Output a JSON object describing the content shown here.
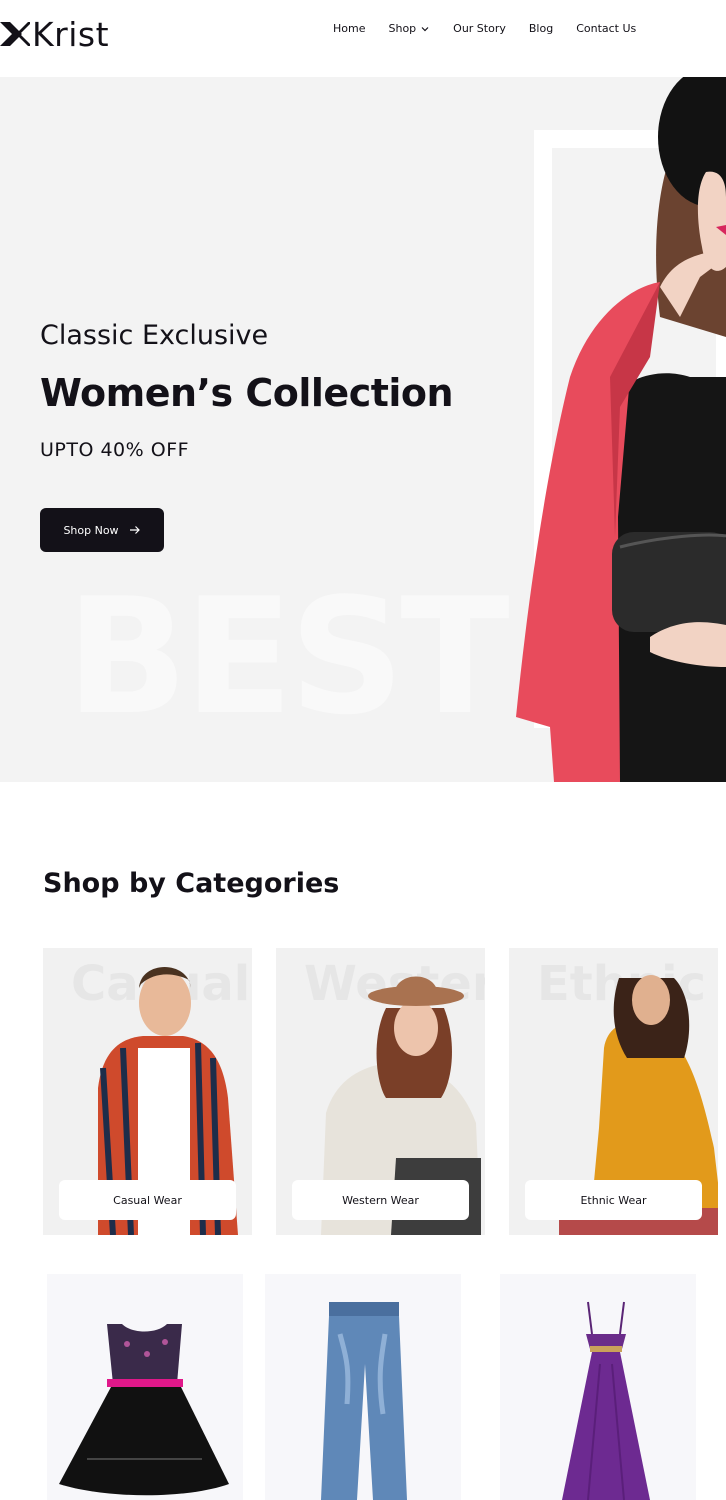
{
  "brand": {
    "name": "Krist",
    "logo_icon": "k-logo-icon"
  },
  "nav": {
    "items": [
      {
        "label": "Home"
      },
      {
        "label": "Shop",
        "has_dropdown": true
      },
      {
        "label": "Our Story"
      },
      {
        "label": "Blog"
      },
      {
        "label": "Contact Us"
      }
    ]
  },
  "hero": {
    "eyebrow": "Classic Exclusive",
    "title": "Women’s Collection",
    "discount": "UPTO 40% OFF",
    "button_label": "Shop Now",
    "button_icon": "arrow-right-icon",
    "watermark": "BEST",
    "colors": {
      "background": "#f3f3f3",
      "coat": "#e84b5c",
      "button": "#131118"
    }
  },
  "categories": {
    "title": "Shop by Categories",
    "items": [
      {
        "label": "Casual Wear",
        "background_word": "Casual"
      },
      {
        "label": "Western Wear",
        "background_word": "Western"
      },
      {
        "label": "Ethnic Wear",
        "background_word": "Ethnic"
      }
    ]
  },
  "products": [
    {
      "image": "party-dress"
    },
    {
      "image": "denim-jeans"
    },
    {
      "image": "purple-gown"
    }
  ]
}
